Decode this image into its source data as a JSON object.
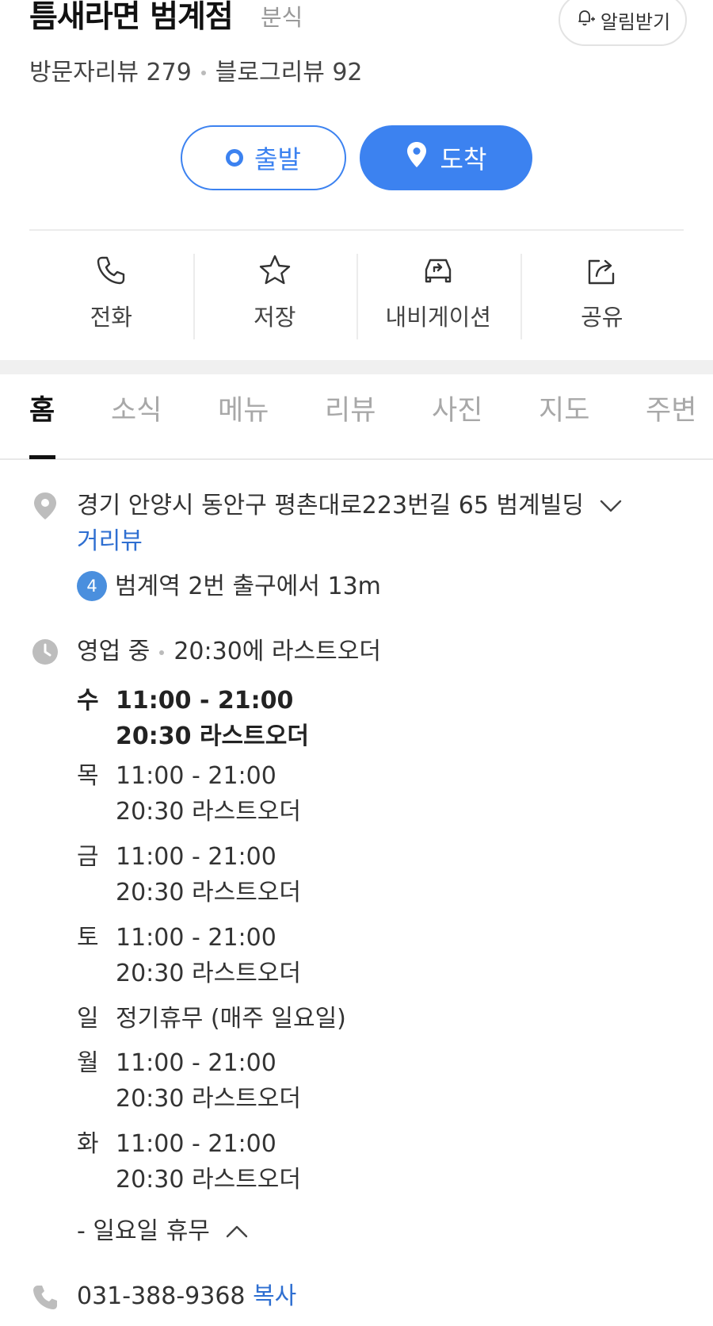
{
  "place": {
    "name": "틈새라면 범계점",
    "category": "분식",
    "alarm_label": "알림받기",
    "visitor_reviews": "방문자리뷰 279",
    "blog_reviews": "블로그리뷰 92"
  },
  "route": {
    "depart_label": "출발",
    "arrive_label": "도착"
  },
  "actions": [
    {
      "label": "전화",
      "icon": "phone-icon"
    },
    {
      "label": "저장",
      "icon": "star-icon"
    },
    {
      "label": "내비게이션",
      "icon": "car-navigation-icon"
    },
    {
      "label": "공유",
      "icon": "share-icon"
    }
  ],
  "tabs": [
    {
      "label": "홈",
      "active": true
    },
    {
      "label": "소식"
    },
    {
      "label": "메뉴"
    },
    {
      "label": "리뷰"
    },
    {
      "label": "사진"
    },
    {
      "label": "지도"
    },
    {
      "label": "주변"
    }
  ],
  "address": {
    "text": "경기 안양시 동안구 평촌대로223번길 65 범계빌딩",
    "street_view": "거리뷰",
    "subway_line": "4",
    "subway_text": "범계역 2번 출구에서 13m"
  },
  "hours": {
    "status": "영업 중",
    "last_order_note": "20:30에 라스트오더",
    "days": [
      {
        "day": "수",
        "time": "11:00 - 21:00",
        "last_order": "20:30 라스트오더",
        "today": true
      },
      {
        "day": "목",
        "time": "11:00 - 21:00",
        "last_order": "20:30 라스트오더"
      },
      {
        "day": "금",
        "time": "11:00 - 21:00",
        "last_order": "20:30 라스트오더"
      },
      {
        "day": "토",
        "time": "11:00 - 21:00",
        "last_order": "20:30 라스트오더"
      },
      {
        "day": "일",
        "time": "정기휴무 (매주 일요일)"
      },
      {
        "day": "월",
        "time": "11:00 - 21:00",
        "last_order": "20:30 라스트오더"
      },
      {
        "day": "화",
        "time": "11:00 - 21:00",
        "last_order": "20:30 라스트오더"
      }
    ],
    "footnote": "- 일요일 휴무"
  },
  "phone": {
    "number": "031-388-9368",
    "copy_label": "복사"
  },
  "colors": {
    "accent_blue": "#3c82f0",
    "link_blue": "#2f6fd1",
    "subway_line_4": "#4a8fde"
  }
}
